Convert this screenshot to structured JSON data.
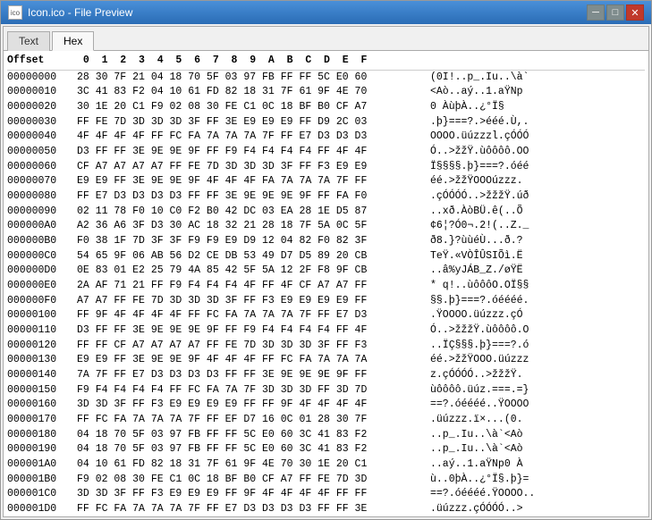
{
  "window": {
    "title": "Icon.ico - File Preview",
    "icon_label": "ico"
  },
  "tabs": [
    {
      "id": "text",
      "label": "Text",
      "active": false
    },
    {
      "id": "hex",
      "label": "Hex",
      "active": true
    }
  ],
  "hex_header": {
    "offset": "Offset",
    "cols": " 0  1  2  3  4  5  6  7  8  9  A  B  C  D  E  F",
    "ascii": ""
  },
  "hex_rows": [
    {
      "offset": "00000000",
      "hex": "28 30 7F 21 04 18 70 5F 03 97 FB FF FF 5C E0 60",
      "ascii": "(0I!..p_.Iu..\\à`"
    },
    {
      "offset": "00000010",
      "hex": "3C 41 83 F2 04 10 61 FD 82 18 31 7F 61 9F 4E 70",
      "ascii": "<Aò..aý..1.aŸNp"
    },
    {
      "offset": "00000020",
      "hex": "30 1E 20 C1 F9 02 08 30 FE C1 0C 18 BF B0 CF A7",
      "ascii": "0 ÀùþÀ..¿°Ï§"
    },
    {
      "offset": "00000030",
      "hex": "FF FE 7D 3D 3D 3D 3F FF 3E E9 E9 E9 FF D9 2C 03",
      "ascii": ".þ}===?.>ééé.Ù,."
    },
    {
      "offset": "00000040",
      "hex": "4F 4F 4F 4F FF FC FA 7A 7A 7A 7F FF E7 D3 D3 D3",
      "ascii": "OOOO.üúzzzl.çÓÓÓ"
    },
    {
      "offset": "00000050",
      "hex": "D3 FF FF 3E 9E 9E 9F FF F9 F4 F4 F4 F4 FF 4F 4F",
      "ascii": "Ó..>žžŸ.ùôôôô.OO"
    },
    {
      "offset": "00000060",
      "hex": "CF A7 A7 A7 A7 FF FE 7D 3D 3D 3D 3F FF F3 E9 E9",
      "ascii": "Ï§§§§.þ}===?.óéé"
    },
    {
      "offset": "00000070",
      "hex": "E9 E9 FF 3E 9E 9E 9F 4F 4F 4F FA 7A 7A 7A 7F FF",
      "ascii": "éé.>žžŸOOOúzzz."
    },
    {
      "offset": "00000080",
      "hex": "FF E7 D3 D3 D3 D3 FF FF 3E 9E 9E 9E 9F FF FA F0",
      "ascii": ".çÓÓÓÓ..>žžžŸ.úð"
    },
    {
      "offset": "00000090",
      "hex": "02 11 78 F0 10 C0 F2 B0 42 DC 03 EA 28 1E D5 87",
      "ascii": "..xð.ÀòBÜ.ê(..Õ"
    },
    {
      "offset": "000000A0",
      "hex": "A2 36 A6 3F D3 30 AC 18 32 21 28 18 7F 5A 0C 5F",
      "ascii": "¢6¦?Ó0¬.2!(..Z._"
    },
    {
      "offset": "000000B0",
      "hex": "F0 38 1F 7D 3F 3F F9 F9 E9 D9 12 04 82 F0 82 3F",
      "ascii": "ð8.}?ùùéÙ...ð.?"
    },
    {
      "offset": "000000C0",
      "hex": "54 65 9F 06 AB 56 D2 CE DB 53 49 D7 D5 89 20 CB",
      "ascii": "TeŸ.«VÒÎÛSIÕì.Ë"
    },
    {
      "offset": "000000D0",
      "hex": "0E 83 01 E2 25 79 4A 85 42 5F 5A 12 2F F8 9F CB",
      "ascii": "..â%yJÁB_Z./øŸË"
    },
    {
      "offset": "000000E0",
      "hex": "2A AF 71 21 FF F9 F4 F4 F4 4F FF 4F CF A7 A7 FF",
      "ascii": "* q!..ùôôôO.OÏ§§"
    },
    {
      "offset": "000000F0",
      "hex": "A7 A7 FF FE 7D 3D 3D 3D 3F FF F3 E9 E9 E9 E9 FF",
      "ascii": "§§.þ}===?.óéééé."
    },
    {
      "offset": "00000100",
      "hex": "FF 9F 4F 4F 4F 4F FF FC FA 7A 7A 7A 7F FF E7 D3",
      "ascii": ".ŸOOOO.üúzzz.çÓ"
    },
    {
      "offset": "00000110",
      "hex": "D3 FF FF 3E 9E 9E 9E 9F FF F9 F4 F4 F4 F4 FF 4F",
      "ascii": "Ó..>žžžŸ.ùôôôô.O"
    },
    {
      "offset": "00000120",
      "hex": "FF FF CF A7 A7 A7 A7 FF FE 7D 3D 3D 3D 3F FF F3",
      "ascii": "..ÏÇ§§§.þ}===?.ó"
    },
    {
      "offset": "00000130",
      "hex": "E9 E9 FF 3E 9E 9E 9F 4F 4F 4F FF FC FA 7A 7A 7A",
      "ascii": "éé.>žžŸOOO.üúzzz"
    },
    {
      "offset": "00000140",
      "hex": "7A 7F FF E7 D3 D3 D3 D3 FF FF 3E 9E 9E 9E 9F FF",
      "ascii": "z.çÓÓÓÓ..>žžžŸ."
    },
    {
      "offset": "00000150",
      "hex": "F9 F4 F4 F4 F4 FF FC FA 7A 7F 3D 3D 3D FF 3D 7D",
      "ascii": "ùôôôô.üúz.===.=}"
    },
    {
      "offset": "00000160",
      "hex": "3D 3D 3F FF F3 E9 E9 E9 E9 FF FF 9F 4F 4F 4F 4F",
      "ascii": "==?.óéééé..ŸOOOO"
    },
    {
      "offset": "00000170",
      "hex": "FF FC FA 7A 7A 7A 7F FF EF D7 16 0C 01 28 30 7F",
      "ascii": ".üúzzz.ï×...(0."
    },
    {
      "offset": "00000180",
      "hex": "04 18 70 5F 03 97 FB FF FF 5C E0 60 3C 41 83 F2",
      "ascii": "..p_.Iu..\\à`<Aò"
    },
    {
      "offset": "00000190",
      "hex": "04 18 70 5F 03 97 FB FF FF 5C E0 60 3C 41 83 F2",
      "ascii": "..p_.Iu..\\à`<Aò"
    },
    {
      "offset": "000001A0",
      "hex": "04 10 61 FD 82 18 31 7F 61 9F 4E 70 30 1E 20 C1",
      "ascii": "..aý..1.aŸNp0 À"
    },
    {
      "offset": "000001B0",
      "hex": "F9 02 08 30 FE C1 0C 18 BF B0 CF A7 FF FE 7D 3D",
      "ascii": "ù..0þÀ..¿°Ï§.þ}="
    },
    {
      "offset": "000001C0",
      "hex": "3D 3D 3F FF F3 E9 E9 E9 FF 9F 4F 4F 4F 4F FF FF",
      "ascii": "==?.óéééé.ŸOOOO.."
    },
    {
      "offset": "000001D0",
      "hex": "FF FC FA 7A 7A 7A 7F FF E7 D3 D3 D3 D3 FF FF 3E",
      "ascii": ".üúzzz.çÓÓÓÓ..>"
    }
  ],
  "buttons": {
    "close": "✕",
    "minimize": "─",
    "maximize": "□"
  }
}
